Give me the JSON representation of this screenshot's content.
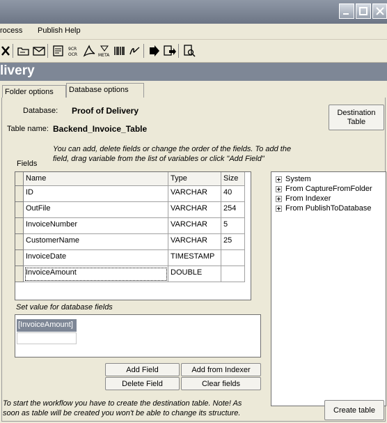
{
  "menu": {
    "items": [
      "rocess",
      "Publish",
      "Help"
    ]
  },
  "toolbar": {
    "icons": [
      "close-icon",
      "open-icon",
      "email-icon",
      "scan-icon",
      "ocr-icon",
      "pdf-icon",
      "meta-icon",
      "barcode-icon",
      "signature-icon",
      "export-icon",
      "publish-icon",
      "preview-icon"
    ]
  },
  "header": {
    "title": "livery"
  },
  "tabs": [
    {
      "label": "Folder options",
      "active": false
    },
    {
      "label": "Database options",
      "active": true
    }
  ],
  "database": {
    "database_label": "Database:",
    "database_value": "Proof of Delivery",
    "table_label": "Table name:",
    "table_value": "Backend_Invoice_Table",
    "destination_button_line1": "Destination",
    "destination_button_line2": "Table"
  },
  "fields": {
    "instructions_line1": "You can add, delete fields or change the order of the fields. To add the",
    "instructions_line2": "field, drag variable from the list of variables or click \"Add Field\"",
    "label": "Fields",
    "columns": [
      "Name",
      "Type",
      "Size"
    ],
    "rows": [
      {
        "name": "ID",
        "type": "VARCHAR",
        "size": "40"
      },
      {
        "name": "OutFile",
        "type": "VARCHAR",
        "size": "254"
      },
      {
        "name": "InvoiceNumber",
        "type": "VARCHAR",
        "size": "5"
      },
      {
        "name": "CustomerName",
        "type": "VARCHAR",
        "size": "25"
      },
      {
        "name": "InvoiceDate",
        "type": "TIMESTAMP",
        "size": ""
      },
      {
        "name": "InvoiceAmount",
        "type": "DOUBLE",
        "size": ""
      }
    ]
  },
  "variables_tree": {
    "items": [
      "System",
      "From CaptureFromFolder",
      "From Indexer",
      "From PublishToDatabase"
    ]
  },
  "set_value": {
    "label": "Set value for database fields",
    "value": "[InvoiceAmount]"
  },
  "buttons": {
    "add_field": "Add Field",
    "add_from_indexer": "Add from Indexer",
    "delete_field": "Delete Field",
    "clear_fields": "Clear fields",
    "create_table": "Create table"
  },
  "footer": {
    "note_line1": "To start the workflow you have to create the destination table. Note! As",
    "note_line2": "soon as table will be created you won't be able to change its structure."
  }
}
